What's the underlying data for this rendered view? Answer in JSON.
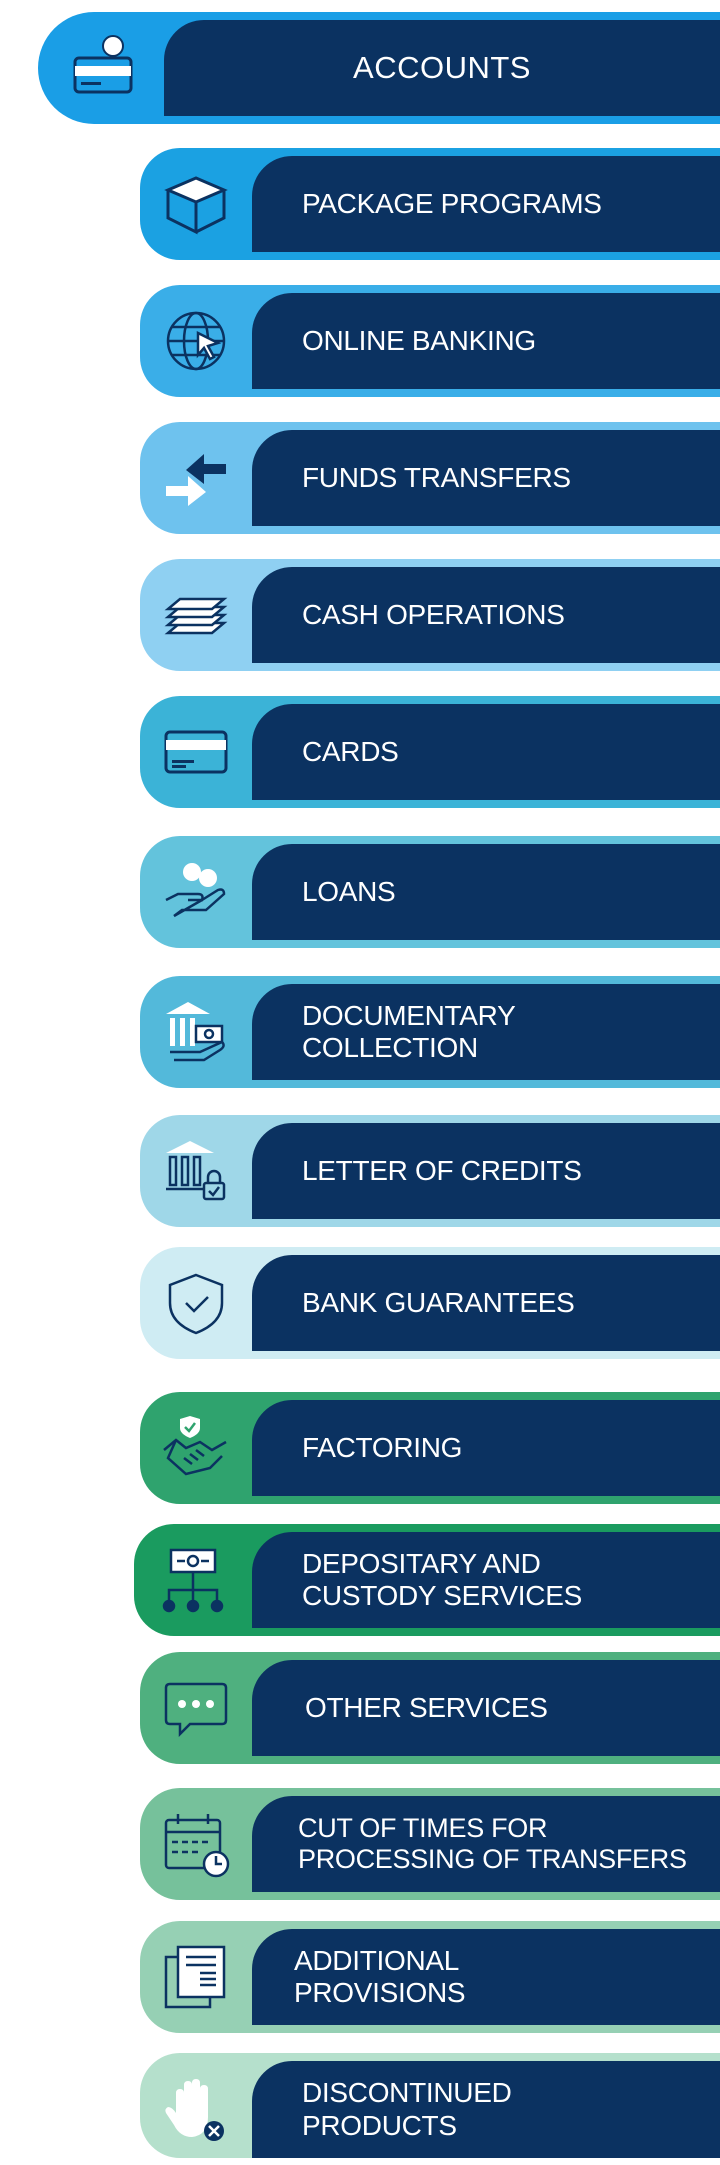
{
  "menu": {
    "items": [
      {
        "label": "ACCOUNTS",
        "icon": "account-card-icon",
        "color": "#1a9ee6"
      },
      {
        "label": "PACKAGE PROGRAMS",
        "icon": "box-icon",
        "color": "#1ba1e2"
      },
      {
        "label": "ONLINE BANKING",
        "icon": "globe-cursor-icon",
        "color": "#3aaee8"
      },
      {
        "label": "FUNDS TRANSFERS",
        "icon": "transfer-arrows-icon",
        "color": "#6ec2ee"
      },
      {
        "label": "CASH OPERATIONS",
        "icon": "cash-stack-icon",
        "color": "#8fd0f2"
      },
      {
        "label": "CARDS",
        "icon": "card-icon",
        "color": "#3bb3d7"
      },
      {
        "label": "LOANS",
        "icon": "hand-coins-icon",
        "color": "#63c3dc"
      },
      {
        "label": "DOCUMENTARY\nCOLLECTION",
        "icon": "bank-document-icon",
        "color": "#53b9da"
      },
      {
        "label": "LETTER OF CREDITS",
        "icon": "bank-lock-icon",
        "color": "#9fd7e8"
      },
      {
        "label": "BANK GUARANTEES",
        "icon": "shield-check-icon",
        "color": "#cfecf3"
      },
      {
        "label": "FACTORING",
        "icon": "handshake-icon",
        "color": "#2fa36e"
      },
      {
        "label": "DEPOSITARY AND\nCUSTODY SERVICES",
        "icon": "custody-network-icon",
        "color": "#1a9b5f"
      },
      {
        "label": "OTHER SERVICES",
        "icon": "chat-dots-icon",
        "color": "#4fb07f"
      },
      {
        "label": "CUT OF TIMES FOR\nPROCESSING OF TRANSFERS",
        "icon": "calendar-clock-icon",
        "color": "#76c19b"
      },
      {
        "label": "ADDITIONAL\nPROVISIONS",
        "icon": "documents-icon",
        "color": "#96d0b4"
      },
      {
        "label": "DISCONTINUED\n PRODUCTS",
        "icon": "hand-stop-icon",
        "color": "#b5e0cc"
      }
    ]
  }
}
